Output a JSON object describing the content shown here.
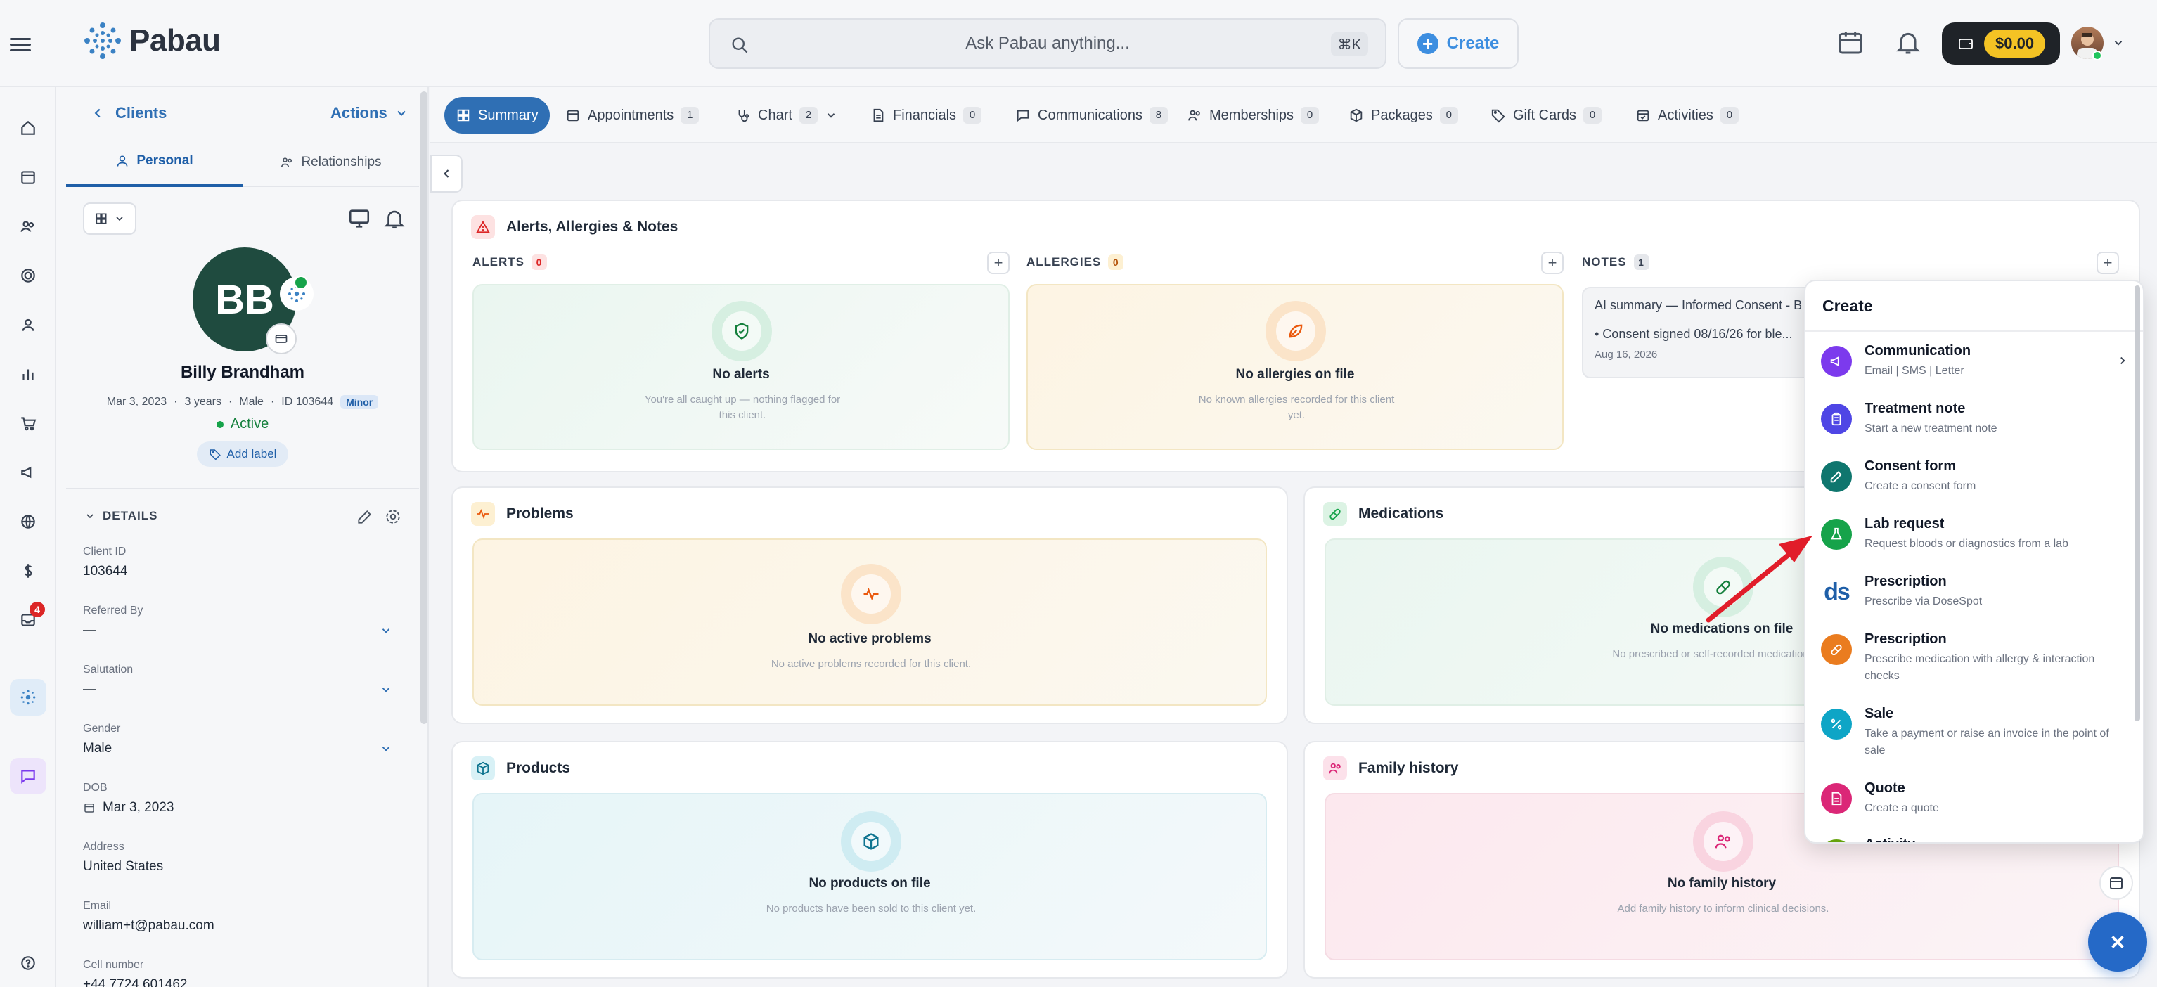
{
  "brand": {
    "name": "Pabau"
  },
  "header": {
    "search_placeholder": "Ask Pabau anything...",
    "search_shortcut": "⌘K",
    "create_label": "Create",
    "balance": "$0.00"
  },
  "rail": {
    "icons": [
      "home-icon",
      "calendar-icon",
      "users-icon",
      "target-icon",
      "contact-icon",
      "reports-icon",
      "cart-icon",
      "megaphone-icon",
      "globe-icon",
      "dollar-icon",
      "inbox-icon",
      "sparkle-icon",
      "chat-icon",
      "help-icon"
    ],
    "inbox_badge": "4"
  },
  "client_panel": {
    "back_label": "Clients",
    "actions_label": "Actions",
    "tabs": [
      "Personal",
      "Relationships"
    ],
    "initials": "BB",
    "name": "Billy Brandham",
    "dob_short": "Mar 3, 2023",
    "age": "3 years",
    "sex": "Male",
    "client_id_text": "ID 103644",
    "minor_badge": "Minor",
    "status": "Active",
    "add_label": "Add label",
    "details_heading": "DETAILS",
    "fields": [
      {
        "label": "Client ID",
        "value": "103644"
      },
      {
        "label": "Referred By",
        "value": "—"
      },
      {
        "label": "Salutation",
        "value": "—"
      },
      {
        "label": "Gender",
        "value": "Male"
      },
      {
        "label": "DOB",
        "value": "Mar 3, 2023"
      },
      {
        "label": "Address",
        "value": "United States"
      },
      {
        "label": "Email",
        "value": "william+t@pabau.com"
      },
      {
        "label": "Cell number",
        "value": "+44 7724 601462"
      }
    ]
  },
  "tabs": [
    {
      "label": "Summary",
      "count": null
    },
    {
      "label": "Appointments",
      "count": "1"
    },
    {
      "label": "Chart",
      "count": "2"
    },
    {
      "label": "Financials",
      "count": "0"
    },
    {
      "label": "Communications",
      "count": "8"
    },
    {
      "label": "Memberships",
      "count": "0"
    },
    {
      "label": "Packages",
      "count": "0"
    },
    {
      "label": "Gift Cards",
      "count": "0"
    },
    {
      "label": "Activities",
      "count": "0"
    }
  ],
  "alerts_card": {
    "title": "Alerts, Allergies & Notes",
    "alerts": {
      "label": "ALERTS",
      "count": "0",
      "empty_title": "No alerts",
      "empty_text": "You're all caught up — nothing flagged for this client."
    },
    "allergies": {
      "label": "ALLERGIES",
      "count": "0",
      "empty_title": "No allergies on file",
      "empty_text": "No known allergies recorded for this client yet."
    },
    "notes": {
      "label": "NOTES",
      "count": "1",
      "note_title": "AI summary — Informed Consent - B",
      "note_body": "• Consent signed 08/16/26 for ble...",
      "note_date": "Aug 16, 2026"
    }
  },
  "problems_card": {
    "title": "Problems",
    "empty_title": "No active problems",
    "empty_text": "No active problems recorded for this client."
  },
  "medications_card": {
    "title": "Medications",
    "empty_title": "No medications on file",
    "empty_text": "No prescribed or self-recorded medications yet."
  },
  "products_card": {
    "title": "Products",
    "empty_title": "No products on file",
    "empty_text": "No products have been sold to this client yet."
  },
  "family_card": {
    "title": "Family history",
    "empty_title": "No family history",
    "empty_text": "Add family history to inform clinical decisions."
  },
  "create_menu": {
    "title": "Create",
    "items": [
      {
        "label": "Communication",
        "desc": "Email | SMS | Letter",
        "color": "#7c3aed",
        "icon": "megaphone-icon"
      },
      {
        "label": "Treatment note",
        "desc": "Start a new treatment note",
        "color": "#4f46e5",
        "icon": "clipboard-icon"
      },
      {
        "label": "Consent form",
        "desc": "Create a consent form",
        "color": "#0f766e",
        "icon": "pen-icon"
      },
      {
        "label": "Lab request",
        "desc": "Request bloods or diagnostics from a lab",
        "color": "#16a34a",
        "icon": "flask-icon"
      },
      {
        "label": "Prescription",
        "desc": "Prescribe via DoseSpot",
        "color": "#ffffff",
        "icon": "dosespot-logo"
      },
      {
        "label": "Prescription",
        "desc": "Prescribe medication with allergy & interaction checks",
        "color": "#ea7c1f",
        "icon": "pill-icon"
      },
      {
        "label": "Sale",
        "desc": "Take a payment or raise an invoice in the point of sale",
        "color": "#0ea5c6",
        "icon": "percent-icon"
      },
      {
        "label": "Quote",
        "desc": "Create a quote",
        "color": "#db2777",
        "icon": "document-icon"
      },
      {
        "label": "Activity",
        "desc": "",
        "color": "#65a30d",
        "icon": "activity-icon"
      }
    ],
    "dosespot_text": "ds"
  }
}
